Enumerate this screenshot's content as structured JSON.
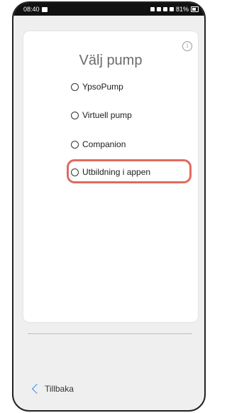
{
  "status_bar": {
    "time": "08:40",
    "battery": "81%"
  },
  "screen": {
    "title": "Välj pump",
    "info_icon": "i",
    "options": [
      {
        "label": "YpsoPump",
        "selected": false
      },
      {
        "label": "Virtuell pump",
        "selected": false
      },
      {
        "label": "Companion",
        "selected": false
      },
      {
        "label": "Utbildning i appen",
        "selected": false,
        "highlighted": true
      }
    ],
    "highlight_color": "#e06a5f"
  },
  "footer": {
    "back_label": "Tillbaka",
    "accent_color": "#3b8fd9"
  }
}
